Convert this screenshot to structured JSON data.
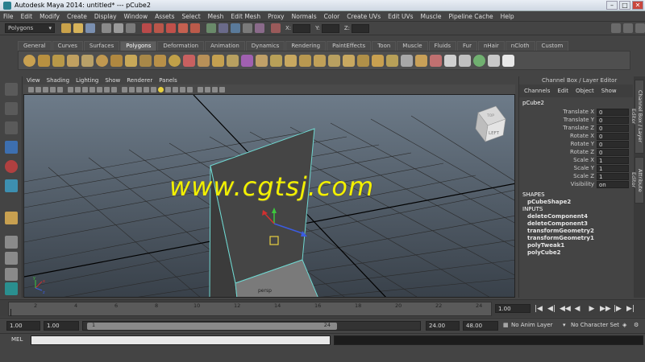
{
  "window": {
    "title": "Autodesk Maya 2014: untitled*   ---   pCube2"
  },
  "menubar": [
    "File",
    "Edit",
    "Modify",
    "Create",
    "Display",
    "Window",
    "Assets",
    "Select",
    "Mesh",
    "Edit Mesh",
    "Proxy",
    "Normals",
    "Color",
    "Create UVs",
    "Edit UVs",
    "Muscle",
    "Pipeline Cache",
    "Help"
  ],
  "statusline": {
    "mode": "Polygons",
    "x_label": "X:",
    "y_label": "Y:",
    "z_label": "Z:"
  },
  "shelf_tabs": [
    "General",
    "Curves",
    "Surfaces",
    "Polygons",
    "Deformation",
    "Animation",
    "Dynamics",
    "Rendering",
    "PaintEffects",
    "Toon",
    "Muscle",
    "Fluids",
    "Fur",
    "nHair",
    "nCloth",
    "Custom"
  ],
  "shelf_active": "Polygons",
  "viewport": {
    "menu": [
      "View",
      "Shading",
      "Lighting",
      "Show",
      "Renderer",
      "Panels"
    ],
    "viewcube_label": "LEFT",
    "viewcube_top": "TOP",
    "face_label": "persp",
    "watermark": "www.cgtsj.com",
    "axis_x": "x",
    "axis_y": "y",
    "axis_z": "z"
  },
  "channel_box": {
    "header": "Channel Box / Layer Editor",
    "menu": [
      "Channels",
      "Edit",
      "Object",
      "Show"
    ],
    "object": "pCube2",
    "attributes": [
      {
        "label": "Translate X",
        "value": "0"
      },
      {
        "label": "Translate Y",
        "value": "0"
      },
      {
        "label": "Translate Z",
        "value": "0"
      },
      {
        "label": "Rotate X",
        "value": "0"
      },
      {
        "label": "Rotate Y",
        "value": "0"
      },
      {
        "label": "Rotate Z",
        "value": "0"
      },
      {
        "label": "Scale X",
        "value": "1"
      },
      {
        "label": "Scale Y",
        "value": "1"
      },
      {
        "label": "Scale Z",
        "value": "1"
      },
      {
        "label": "Visibility",
        "value": "on"
      }
    ],
    "shapes_header": "SHAPES",
    "shapes": [
      "pCubeShape2"
    ],
    "inputs_header": "INPUTS",
    "inputs": [
      "deleteComponent4",
      "deleteComponent3",
      "transformGeometry2",
      "transformGeometry1",
      "polyTweak1",
      "polyCube2"
    ]
  },
  "side_tabs": [
    "Channel Box / Layer Editor",
    "Attribute Editor"
  ],
  "timeline": {
    "ticks": [
      "2",
      "4",
      "6",
      "8",
      "10",
      "12",
      "14",
      "16",
      "18",
      "20",
      "22",
      "24"
    ],
    "current_frame": "1.00",
    "playback_buttons": [
      "|◀",
      "◀|",
      "◀◀",
      "◀",
      "▶",
      "▶▶",
      "|▶",
      "▶|"
    ]
  },
  "range": {
    "start": "1.00",
    "playback_start": "1.00",
    "handle_start": "1",
    "handle_end": "24",
    "playback_end": "24.00",
    "end": "48.00",
    "anim_layer": "No Anim Layer",
    "character_set": "No Character Set"
  },
  "command": {
    "label": "MEL"
  }
}
